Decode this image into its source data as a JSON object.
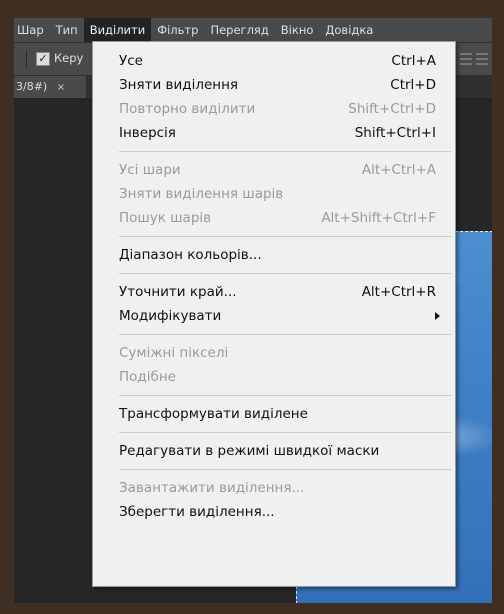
{
  "menubar": {
    "items": [
      "Шар",
      "Тип",
      "Виділити",
      "Фільтр",
      "Перегляд",
      "Вікно",
      "Довідка"
    ],
    "active_index": 2
  },
  "optionsbar": {
    "checkbox_label": "Керу",
    "checkbox_checked": true
  },
  "tab": {
    "title": "3/8#)",
    "close": "×"
  },
  "menu": {
    "groups": [
      [
        {
          "label": "Усе",
          "shortcut": "Ctrl+A",
          "enabled": true
        },
        {
          "label": "Зняти виділення",
          "shortcut": "Ctrl+D",
          "enabled": true
        },
        {
          "label": "Повторно виділити",
          "shortcut": "Shift+Ctrl+D",
          "enabled": false
        },
        {
          "label": "Інверсія",
          "shortcut": "Shift+Ctrl+I",
          "enabled": true
        }
      ],
      [
        {
          "label": "Усі шари",
          "shortcut": "Alt+Ctrl+A",
          "enabled": false
        },
        {
          "label": "Зняти виділення шарів",
          "shortcut": "",
          "enabled": false
        },
        {
          "label": "Пошук шарів",
          "shortcut": "Alt+Shift+Ctrl+F",
          "enabled": false
        }
      ],
      [
        {
          "label": "Діапазон кольорів...",
          "shortcut": "",
          "enabled": true
        }
      ],
      [
        {
          "label": "Уточнити край...",
          "shortcut": "Alt+Ctrl+R",
          "enabled": true
        },
        {
          "label": "Модифікувати",
          "shortcut": "",
          "enabled": true,
          "submenu": true
        }
      ],
      [
        {
          "label": "Суміжні пікселі",
          "shortcut": "",
          "enabled": false
        },
        {
          "label": "Подібне",
          "shortcut": "",
          "enabled": false
        }
      ],
      [
        {
          "label": "Трансформувати виділене",
          "shortcut": "",
          "enabled": true
        }
      ],
      [
        {
          "label": "Редагувати в режимі швидкої маски",
          "shortcut": "",
          "enabled": true
        }
      ],
      [
        {
          "label": "Завантажити виділення...",
          "shortcut": "",
          "enabled": false
        },
        {
          "label": "Зберегти виділення...",
          "shortcut": "",
          "enabled": true
        }
      ]
    ]
  },
  "colors": {
    "menu_bg": "#f0f0f0",
    "disabled_text": "#9a9a9a",
    "app_bg": "#262626",
    "frame_bg": "#3f2e22"
  }
}
